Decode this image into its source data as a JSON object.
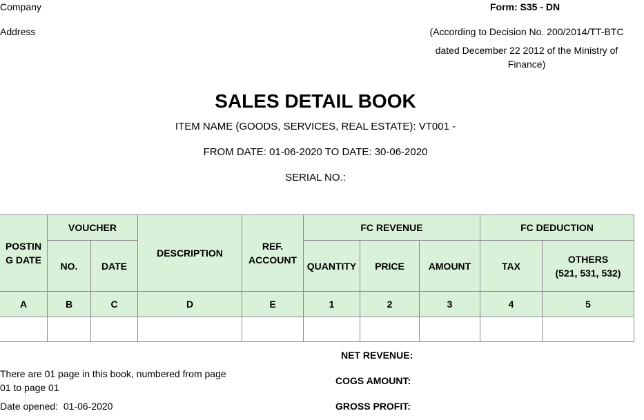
{
  "header": {
    "company_label": "Company",
    "address_label": "Address",
    "form_code": "Form: S35 - DN",
    "decision_line1": "(According to Decision No. 200/2014/TT-BTC",
    "decision_line2": "dated December 22 2012 of the Ministry of",
    "decision_line3": "Finance)"
  },
  "title": {
    "main": "SALES DETAIL BOOK",
    "item_name": "ITEM NAME (GOODS, SERVICES, REAL ESTATE): VT001 -",
    "date_range": "FROM DATE: 01-06-2020 TO DATE: 30-06-2020",
    "serial": "SERIAL NO.:"
  },
  "table": {
    "posting_date_line1": "POSTIN",
    "posting_date_line2": "G DATE",
    "voucher": "VOUCHER",
    "voucher_no": "NO.",
    "voucher_date": "DATE",
    "description": "DESCRIPTION",
    "ref_line1": "REF.",
    "ref_line2": "ACCOUNT",
    "fc_revenue": "FC REVENUE",
    "quantity": "QUANTITY",
    "price": "PRICE",
    "amount": "AMOUNT",
    "fc_deduction": "FC DEDUCTION",
    "tax": "TAX",
    "others_line1": "OTHERS",
    "others_line2": "(521, 531, 532)",
    "codes": [
      "A",
      "B",
      "C",
      "D",
      "E",
      "1",
      "2",
      "3",
      "4",
      "5"
    ]
  },
  "summary": {
    "net_revenue": "NET REVENUE:",
    "cogs_amount": "COGS AMOUNT:",
    "gross_profit": "GROSS PROFIT:"
  },
  "footer": {
    "pages_line1": "There are 01 page in this book, numbered from page",
    "pages_line2": "01 to page 01",
    "date_opened_label": "Date opened:",
    "date_opened_value": "01-06-2020"
  },
  "colors": {
    "header_fill": "#d9f1d9",
    "grid": "#8a8a8a"
  }
}
